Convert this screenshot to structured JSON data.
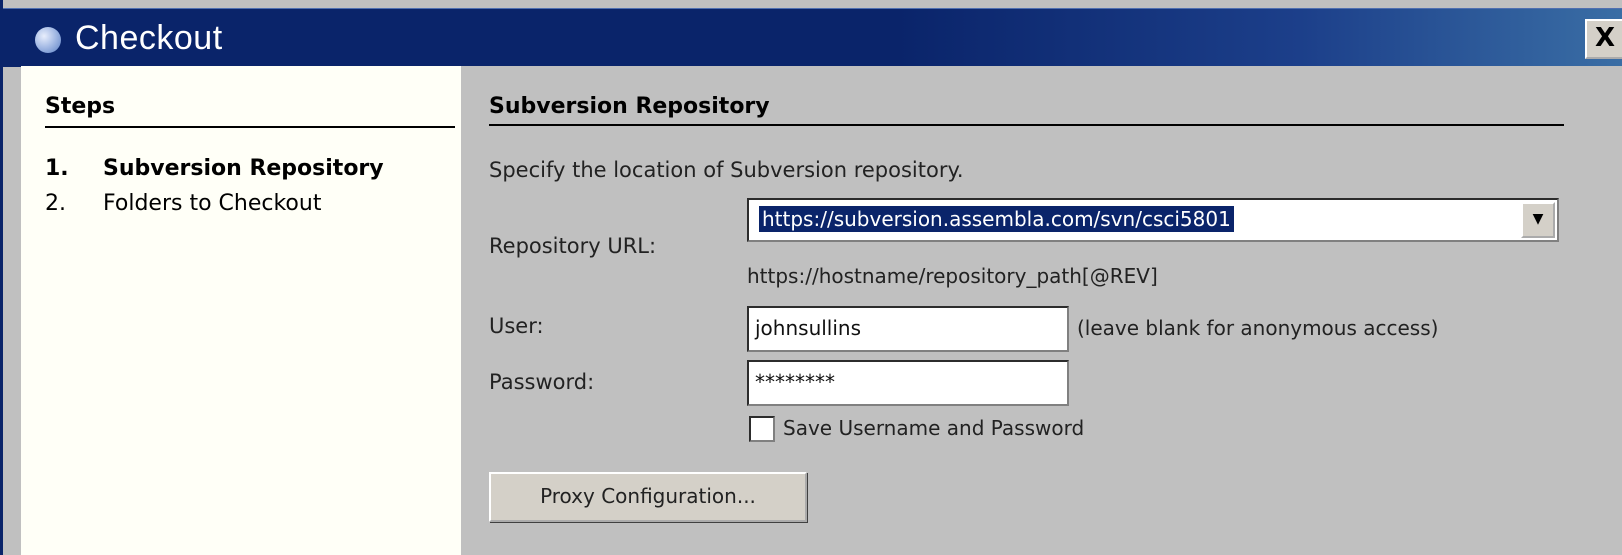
{
  "window": {
    "title": "Checkout",
    "close_label": "X"
  },
  "steps": {
    "heading": "Steps",
    "items": [
      {
        "number": "1.",
        "label": "Subversion Repository"
      },
      {
        "number": "2.",
        "label": "Folders to Checkout"
      }
    ]
  },
  "main": {
    "section_title": "Subversion Repository",
    "description": "Specify the location of Subversion repository.",
    "repository_url": {
      "label": "Repository URL:",
      "value": "https://subversion.assembla.com/svn/csci5801",
      "hint": "https://hostname/repository_path[@REV]"
    },
    "user": {
      "label": "User:",
      "value": "johnsullins",
      "note": "(leave blank for anonymous access)"
    },
    "password": {
      "label": "Password:",
      "value": "********"
    },
    "save_credentials": {
      "label": "Save Username and Password",
      "checked": false
    },
    "proxy_button": "Proxy Configuration..."
  },
  "icons": {
    "title_icon": "app-cube-icon",
    "dropdown": "chevron-down-icon"
  }
}
